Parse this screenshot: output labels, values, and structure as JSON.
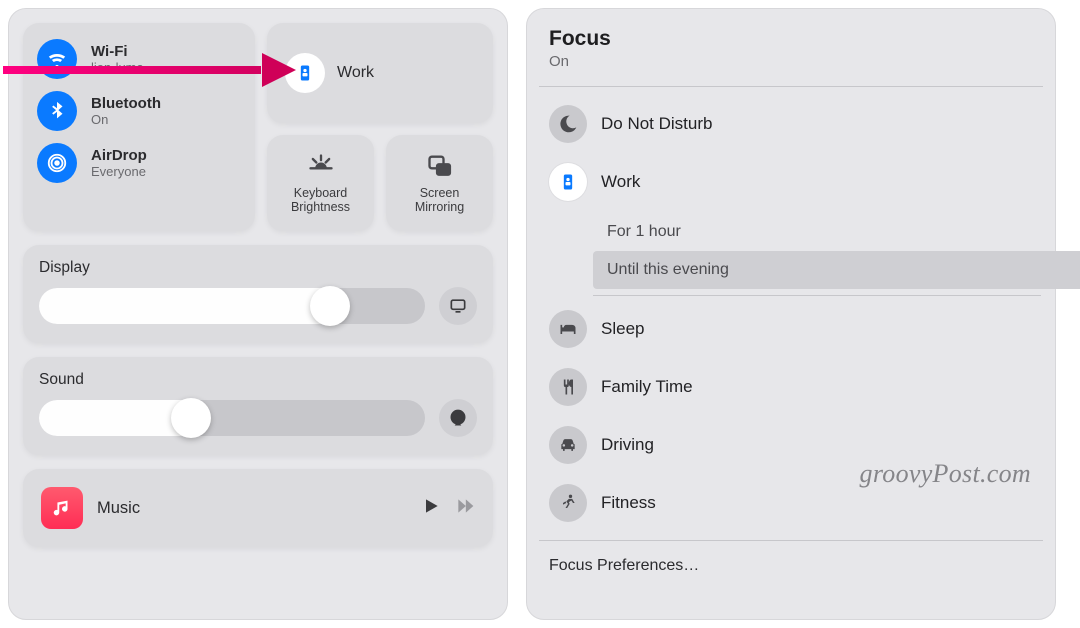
{
  "control_center": {
    "wifi": {
      "label": "Wi-Fi",
      "status": "lion-luma"
    },
    "bluetooth": {
      "label": "Bluetooth",
      "status": "On"
    },
    "airdrop": {
      "label": "AirDrop",
      "status": "Everyone"
    },
    "focus_tile": {
      "label": "Work"
    },
    "kb_brightness": {
      "label": "Keyboard\nBrightness"
    },
    "screen_mirror": {
      "label": "Screen\nMirroring"
    },
    "display": {
      "label": "Display"
    },
    "sound": {
      "label": "Sound"
    },
    "music": {
      "label": "Music"
    }
  },
  "focus_panel": {
    "title": "Focus",
    "state": "On",
    "modes": {
      "dnd": "Do Not Disturb",
      "work": "Work",
      "sleep": "Sleep",
      "family": "Family Time",
      "driving": "Driving",
      "fitness": "Fitness"
    },
    "work_options": {
      "hour": "For 1 hour",
      "evening": "Until this evening"
    },
    "prefs": "Focus Preferences…"
  },
  "watermark": "groovyPost.com"
}
